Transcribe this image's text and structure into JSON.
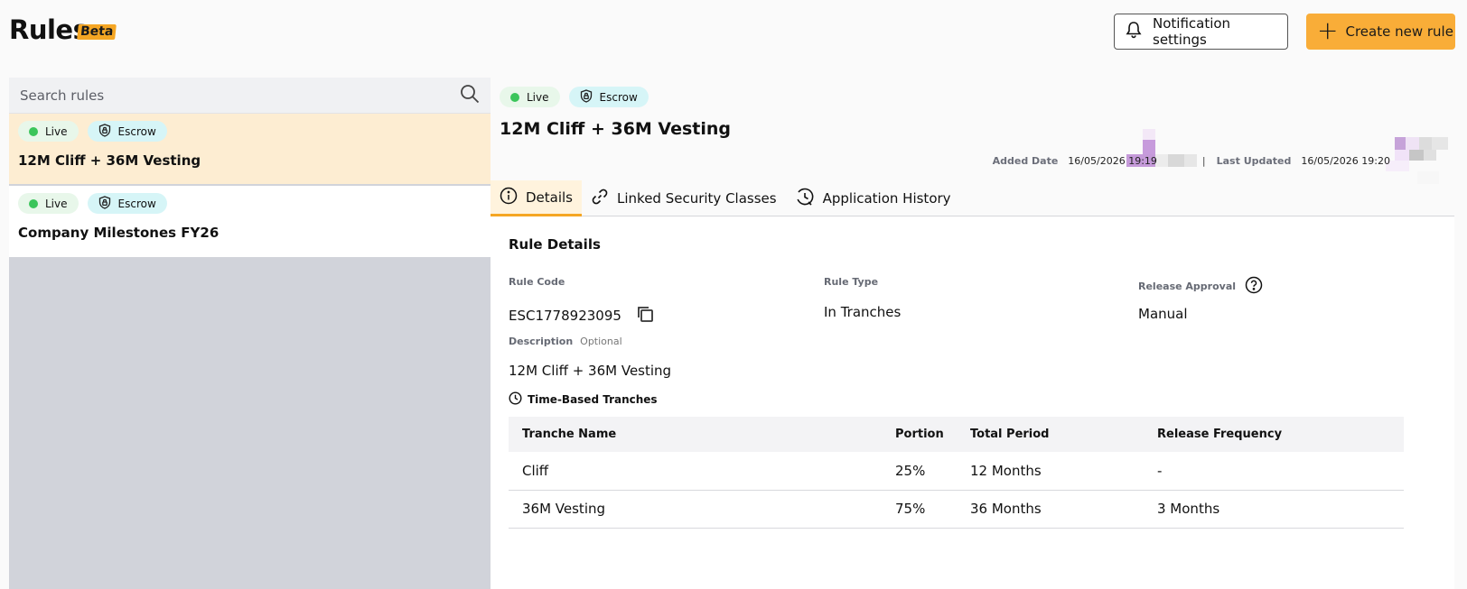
{
  "header": {
    "title": "Rules",
    "beta": "Beta",
    "notification_button": "Notification settings",
    "create_button": "Create new rule",
    "accent_color": "#f9ad38"
  },
  "search": {
    "placeholder": "Search rules"
  },
  "rules": [
    {
      "status": "Live",
      "type": "Escrow",
      "name": "12M Cliff + 36M Vesting",
      "selected": true
    },
    {
      "status": "Live",
      "type": "Escrow",
      "name": "Company Milestones FY26",
      "selected": false
    }
  ],
  "detail": {
    "status": "Live",
    "type": "Escrow",
    "title": "12M Cliff + 36M Vesting",
    "added_date_label": "Added Date",
    "added_date": "16/05/2026 19:19",
    "last_updated_label": "Last Updated",
    "last_updated": "16/05/2026 19:20",
    "separator": "|",
    "tabs": [
      {
        "label": "Details",
        "icon": "info-icon",
        "active": true
      },
      {
        "label": "Linked Security Classes",
        "icon": "link-icon",
        "active": false
      },
      {
        "label": "Application History",
        "icon": "history-icon",
        "active": false
      }
    ],
    "section_title": "Rule Details",
    "rule_code_label": "Rule Code",
    "rule_code": "ESC1778923095",
    "rule_type_label": "Rule Type",
    "rule_type": "In Tranches",
    "release_approval_label": "Release Approval",
    "release_approval": "Manual",
    "description_label": "Description",
    "description_optional": "Optional",
    "description": "12M Cliff + 36M Vesting",
    "tranches_title": "Time-Based Tranches",
    "table": {
      "headers": [
        "Tranche Name",
        "Portion",
        "Total Period",
        "Release Frequency"
      ],
      "rows": [
        [
          "Cliff",
          "25%",
          "12 Months",
          "-"
        ],
        [
          "36M Vesting",
          "75%",
          "36 Months",
          "3 Months"
        ]
      ]
    }
  }
}
